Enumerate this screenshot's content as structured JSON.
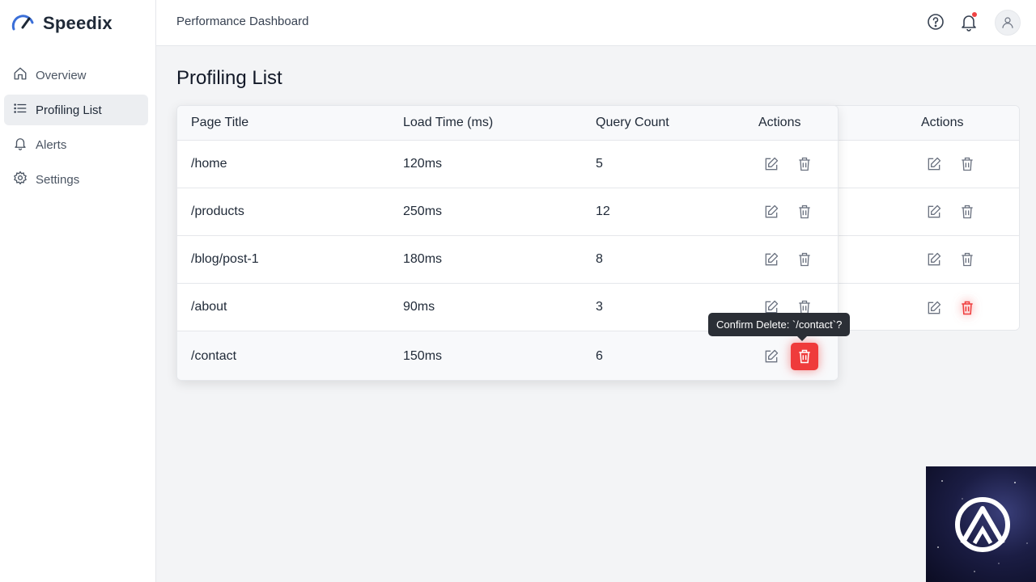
{
  "brand": {
    "name": "Speedix",
    "accent": "#3b6fd8"
  },
  "sidebar": {
    "items": [
      {
        "label": "Overview",
        "icon": "home-icon",
        "active": false
      },
      {
        "label": "Profiling List",
        "icon": "list-icon",
        "active": true
      },
      {
        "label": "Alerts",
        "icon": "bell-icon",
        "active": false
      },
      {
        "label": "Settings",
        "icon": "gear-icon",
        "active": false
      }
    ]
  },
  "header": {
    "title": "Performance Dashboard",
    "icons": [
      "help-icon",
      "notification-bell-icon",
      "user-avatar-icon"
    ],
    "notification_dot_color": "#ef4444"
  },
  "page": {
    "title": "Profiling List"
  },
  "table": {
    "columns": [
      "Page Title",
      "Load Time (ms)",
      "Query Count",
      "Actions"
    ],
    "rows": [
      {
        "page": "/home",
        "load": "120ms",
        "queries": "5"
      },
      {
        "page": "/products",
        "load": "250ms",
        "queries": "12"
      },
      {
        "page": "/blog/post-1",
        "load": "180ms",
        "queries": "8"
      },
      {
        "page": "/about",
        "load": "90ms",
        "queries": "3"
      },
      {
        "page": "/contact",
        "load": "150ms",
        "queries": "6"
      }
    ],
    "action_icons": [
      "edit-icon",
      "trash-icon"
    ],
    "danger_color": "#ef3b3b"
  },
  "back_table": {
    "actions_header": "Actions"
  },
  "tooltip": {
    "text": "Confirm Delete: `/contact`?"
  }
}
